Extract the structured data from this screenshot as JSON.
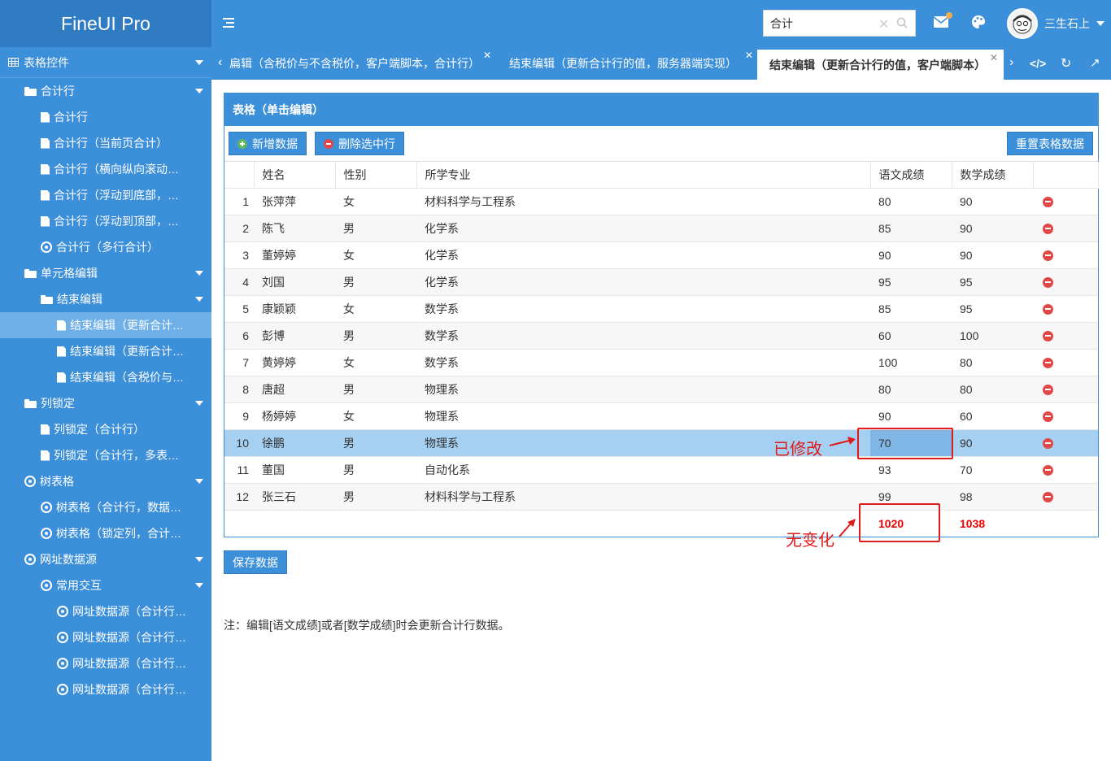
{
  "brand": "FineUI Pro",
  "sidebar": {
    "section_title": "表格控件",
    "items": [
      {
        "label": "合计行",
        "icon": "folder-icon",
        "level": 1,
        "caret": true
      },
      {
        "label": "合计行",
        "icon": "file-icon",
        "level": 2
      },
      {
        "label": "合计行（当前页合计）",
        "icon": "file-icon",
        "level": 2
      },
      {
        "label": "合计行（横向纵向滚动条）",
        "icon": "file-icon",
        "level": 2
      },
      {
        "label": "合计行（浮动到底部，横…",
        "icon": "file-icon",
        "level": 2
      },
      {
        "label": "合计行（浮动到顶部，横…",
        "icon": "file-icon",
        "level": 2
      },
      {
        "label": "合计行（多行合计）",
        "icon": "circle-icon",
        "level": 2
      },
      {
        "label": "单元格编辑",
        "icon": "folder-icon",
        "level": 1,
        "caret": true
      },
      {
        "label": "结束编辑",
        "icon": "folder-icon",
        "level": 2,
        "caret": true
      },
      {
        "label": "结束编辑（更新合计…",
        "icon": "file-icon",
        "level": 3,
        "selected": true
      },
      {
        "label": "结束编辑（更新合计…",
        "icon": "file-icon",
        "level": 3
      },
      {
        "label": "结束编辑（含税价与…",
        "icon": "file-icon",
        "level": 3
      },
      {
        "label": "列锁定",
        "icon": "folder-icon",
        "level": 1,
        "caret": true
      },
      {
        "label": "列锁定（合计行）",
        "icon": "file-icon",
        "level": 2
      },
      {
        "label": "列锁定（合计行，多表头…",
        "icon": "file-icon",
        "level": 2
      },
      {
        "label": "树表格",
        "icon": "circle-icon",
        "level": 1,
        "caret": true
      },
      {
        "label": "树表格（合计行，数据库…",
        "icon": "circle-icon",
        "level": 2
      },
      {
        "label": "树表格（锁定列，合计行…",
        "icon": "circle-icon",
        "level": 2
      },
      {
        "label": "网址数据源",
        "icon": "circle-icon",
        "level": 1,
        "caret": true
      },
      {
        "label": "常用交互",
        "icon": "circle-icon",
        "level": 2,
        "caret": true
      },
      {
        "label": "网址数据源（合计行…",
        "icon": "circle-icon",
        "level": 3
      },
      {
        "label": "网址数据源（合计行…",
        "icon": "circle-icon",
        "level": 3
      },
      {
        "label": "网址数据源（合计行…",
        "icon": "circle-icon",
        "level": 3
      },
      {
        "label": "网址数据源（合计行…",
        "icon": "circle-icon",
        "level": 3
      }
    ]
  },
  "header": {
    "search_value": "合计",
    "user_name": "三生石上"
  },
  "tabs": [
    {
      "label": "扁辑（含税价与不含税价，客户端脚本，合计行）",
      "active": false
    },
    {
      "label": "结束编辑（更新合计行的值，服务器端实现）",
      "active": false
    },
    {
      "label": "结束编辑（更新合计行的值，客户端脚本）",
      "active": true
    }
  ],
  "panel": {
    "title": "表格（单击编辑）",
    "add_button": "新增数据",
    "delete_button": "删除选中行",
    "reset_button": "重置表格数据",
    "columns": [
      "姓名",
      "性别",
      "所学专业",
      "语文成绩",
      "数学成绩"
    ],
    "rows": [
      {
        "num": "1",
        "name": "张萍萍",
        "gender": "女",
        "major": "材料科学与工程系",
        "chinese": "80",
        "math": "90"
      },
      {
        "num": "2",
        "name": "陈飞",
        "gender": "男",
        "major": "化学系",
        "chinese": "85",
        "math": "90"
      },
      {
        "num": "3",
        "name": "董婷婷",
        "gender": "女",
        "major": "化学系",
        "chinese": "90",
        "math": "90"
      },
      {
        "num": "4",
        "name": "刘国",
        "gender": "男",
        "major": "化学系",
        "chinese": "95",
        "math": "95"
      },
      {
        "num": "5",
        "name": "康颖颖",
        "gender": "女",
        "major": "数学系",
        "chinese": "85",
        "math": "95"
      },
      {
        "num": "6",
        "name": "彭博",
        "gender": "男",
        "major": "数学系",
        "chinese": "60",
        "math": "100"
      },
      {
        "num": "7",
        "name": "黄婷婷",
        "gender": "女",
        "major": "数学系",
        "chinese": "100",
        "math": "80"
      },
      {
        "num": "8",
        "name": "唐超",
        "gender": "男",
        "major": "物理系",
        "chinese": "80",
        "math": "80"
      },
      {
        "num": "9",
        "name": "杨婷婷",
        "gender": "女",
        "major": "物理系",
        "chinese": "90",
        "math": "60"
      },
      {
        "num": "10",
        "name": "徐鹏",
        "gender": "男",
        "major": "物理系",
        "chinese": "70",
        "math": "90",
        "selected": true
      },
      {
        "num": "11",
        "name": "董国",
        "gender": "男",
        "major": "自动化系",
        "chinese": "93",
        "math": "70"
      },
      {
        "num": "12",
        "name": "张三石",
        "gender": "男",
        "major": "材料科学与工程系",
        "chinese": "99",
        "math": "98"
      }
    ],
    "summary": {
      "chinese": "1020",
      "math": "1038"
    }
  },
  "save_button": "保存数据",
  "note": "注：编辑[语文成绩]或者[数学成绩]时会更新合计行数据。",
  "annotations": {
    "modified": "已修改",
    "unchanged": "无变化"
  },
  "colors": {
    "primary": "#3c8fd9",
    "annotation": "#e01b1b"
  }
}
